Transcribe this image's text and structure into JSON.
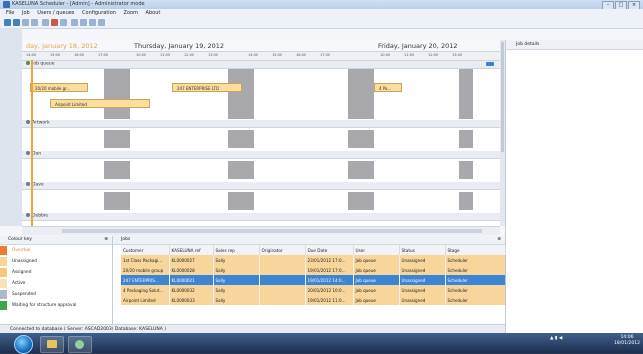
{
  "window": {
    "title": "KASELUNA Scheduler - [Admin] - Administrator mode",
    "controls": [
      "–",
      "□",
      "×"
    ]
  },
  "menu": [
    "File",
    "Job",
    "Users / queues",
    "Configuration",
    "Zoom",
    "About"
  ],
  "schedule": {
    "dates": [
      "day, January 18, 2012",
      "Thursday, January 19, 2012",
      "Friday, January 20, 2012"
    ],
    "times": [
      "14:00",
      "15:00",
      "16:00",
      "17:00",
      "10:00",
      "11:00",
      "12:00",
      "13:00",
      "14:00",
      "15:00",
      "16:00",
      "17:00",
      "10:00",
      "11:00",
      "12:00",
      "13:00"
    ],
    "groups": [
      "Job queue",
      "Artwork",
      "Dan",
      "Dave",
      "Debbie"
    ],
    "tasks": [
      "20/20 mobile gr...",
      "Airpoint Limited",
      "247 ENTERPRISE LTD",
      "4 Pa..."
    ]
  },
  "job_details": {
    "title": "Job details"
  },
  "colour_key": {
    "title": "Colour key",
    "items": [
      {
        "label": "Overdue",
        "color": "#f07a30"
      },
      {
        "label": "Unassigned",
        "color": "#f8d59a"
      },
      {
        "label": "Assigned",
        "color": "#f6c77e"
      },
      {
        "label": "Active",
        "color": "#f7e3b8"
      },
      {
        "label": "Suspended",
        "color": "#b0b8c4"
      },
      {
        "label": "Waiting for structure approval",
        "color": "#3fa74a"
      }
    ]
  },
  "jobs": {
    "title": "Jobs",
    "columns": [
      "Customer",
      "KASELUNA ref",
      "Sales rep",
      "Originator",
      "Due Date",
      "User",
      "Status",
      "Stage"
    ],
    "rows": [
      [
        "1st Class Packagi...",
        "KL0000027",
        "Sally",
        "",
        "23/01/2012 17:0...",
        "Job queue",
        "Unassigned",
        "Scheduler"
      ],
      [
        "20/20 mobile group",
        "KL0000028",
        "Sally",
        "",
        "19/01/2012 17:0...",
        "Job queue",
        "Unassigned",
        "Scheduler"
      ],
      [
        "247 ENTERPRIS...",
        "KL0000021",
        "Sally",
        "",
        "19/01/2012 14:0...",
        "Job queue",
        "Unassigned",
        "Scheduler"
      ],
      [
        "4 Packaging Solut...",
        "KL0000032",
        "Sally",
        "",
        "20/01/2012 10:0...",
        "Job queue",
        "Unassigned",
        "Scheduler"
      ],
      [
        "Airpoint Limited",
        "KL0000033",
        "Sally",
        "",
        "19/01/2012 11:0...",
        "Job queue",
        "Unassigned",
        "Scheduler"
      ]
    ],
    "selected_row": 2
  },
  "status_bar": "Connected to database ( Server: ASCAD2003\\ Database: KASELUNA )",
  "taskbar": {
    "time": "14:06",
    "date": "18/01/2012"
  }
}
